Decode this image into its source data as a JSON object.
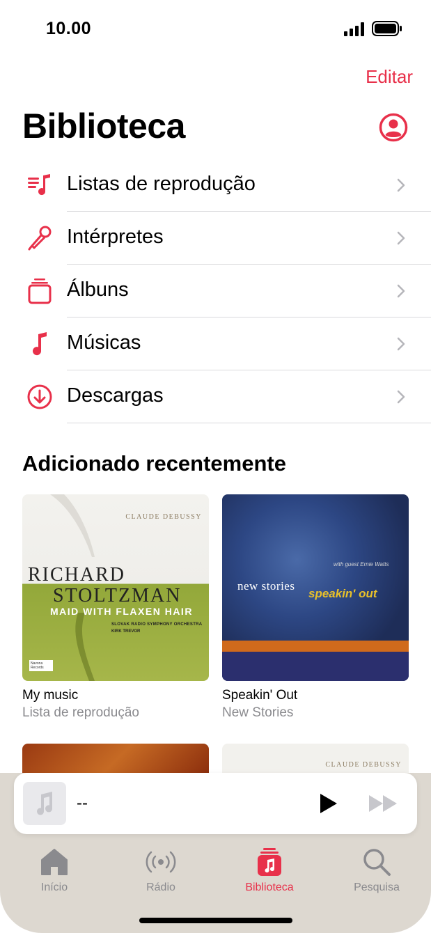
{
  "status": {
    "time": "10.00"
  },
  "header": {
    "edit_label": "Editar",
    "title": "Biblioteca"
  },
  "library": {
    "items": [
      {
        "label": "Listas de reprodução",
        "icon": "playlist-icon"
      },
      {
        "label": "Intérpretes",
        "icon": "microphone-icon"
      },
      {
        "label": "Álbuns",
        "icon": "album-stack-icon"
      },
      {
        "label": "Músicas",
        "icon": "music-note-icon"
      },
      {
        "label": "Descargas",
        "icon": "download-icon"
      }
    ]
  },
  "recent": {
    "title": "Adicionado recentemente",
    "albums": [
      {
        "title": "My music",
        "subtitle": "Lista de reprodução",
        "cover": {
          "brand": "CLAUDE DEBUSSY",
          "artist_line1": "RICHARD",
          "artist_line2": "STOLTZMAN",
          "album": "MAID WITH FLAXEN HAIR",
          "orchestra": "SLOVAK RADIO SYMPHONY ORCHESTRA",
          "conductor": "KIRK TREVOR",
          "label": "Navona Records"
        }
      },
      {
        "title": "Speakin' Out",
        "subtitle": "New Stories",
        "cover": {
          "band": "new stories",
          "album": "speakin' out",
          "guest": "with guest Ernie Watts"
        }
      }
    ],
    "peek_brand": "CLAUDE DEBUSSY"
  },
  "player": {
    "title": "--"
  },
  "tabs": [
    {
      "label": "Início",
      "icon": "home-icon",
      "active": false
    },
    {
      "label": "Rádio",
      "icon": "radio-icon",
      "active": false
    },
    {
      "label": "Biblioteca",
      "icon": "library-icon",
      "active": true
    },
    {
      "label": "Pesquisa",
      "icon": "search-icon",
      "active": false
    }
  ],
  "colors": {
    "accent": "#e8304a",
    "secondary_text": "#8a8a8e",
    "panel": "#ddd8d0"
  }
}
